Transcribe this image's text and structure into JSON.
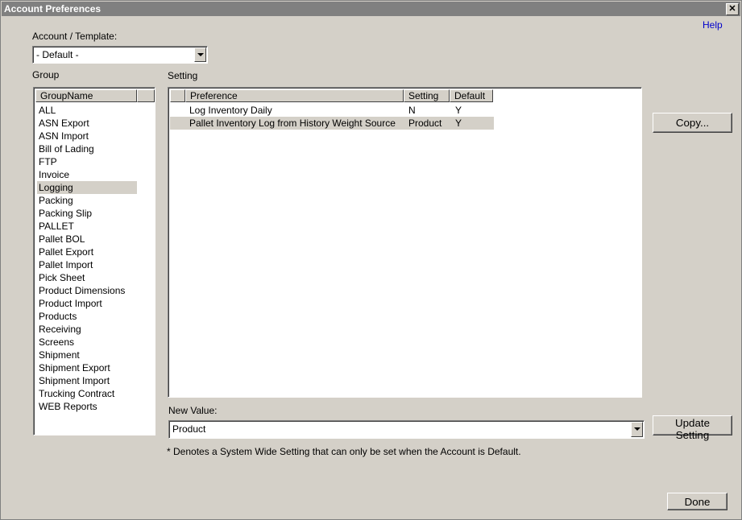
{
  "window": {
    "title": "Account Preferences",
    "close_glyph": "✕"
  },
  "help_link": "Help",
  "account": {
    "label": "Account / Template:",
    "value": "- Default -"
  },
  "group": {
    "label": "Group",
    "column": "GroupName",
    "items": [
      "ALL",
      "ASN Export",
      "ASN Import",
      "Bill of Lading",
      "FTP",
      "Invoice",
      "Logging",
      "Packing",
      "Packing Slip",
      "PALLET",
      "Pallet BOL",
      "Pallet Export",
      "Pallet Import",
      "Pick Sheet",
      "Product Dimensions",
      "Product Import",
      "Products",
      "Receiving",
      "Screens",
      "Shipment",
      "Shipment Export",
      "Shipment Import",
      "Trucking Contract",
      "WEB Reports"
    ],
    "selected": "Logging"
  },
  "setting": {
    "label": "Setting",
    "columns": {
      "preference": "Preference",
      "setting": "Setting",
      "default": "Default"
    },
    "rows": [
      {
        "preference": "Log Inventory Daily",
        "setting": "N",
        "default": "Y"
      },
      {
        "preference": "Pallet Inventory Log from History Weight Source",
        "setting": "Product",
        "default": "Y"
      }
    ],
    "selected_row": 1
  },
  "new_value": {
    "label": "New Value:",
    "value": "Product"
  },
  "buttons": {
    "copy": "Copy...",
    "update": "Update Setting",
    "done": "Done"
  },
  "note": "* Denotes a System Wide Setting that can only be set when the Account is Default.",
  "colors": {
    "background": "#d4d0c8",
    "titlebar": "#808080",
    "link": "#0000cc"
  }
}
